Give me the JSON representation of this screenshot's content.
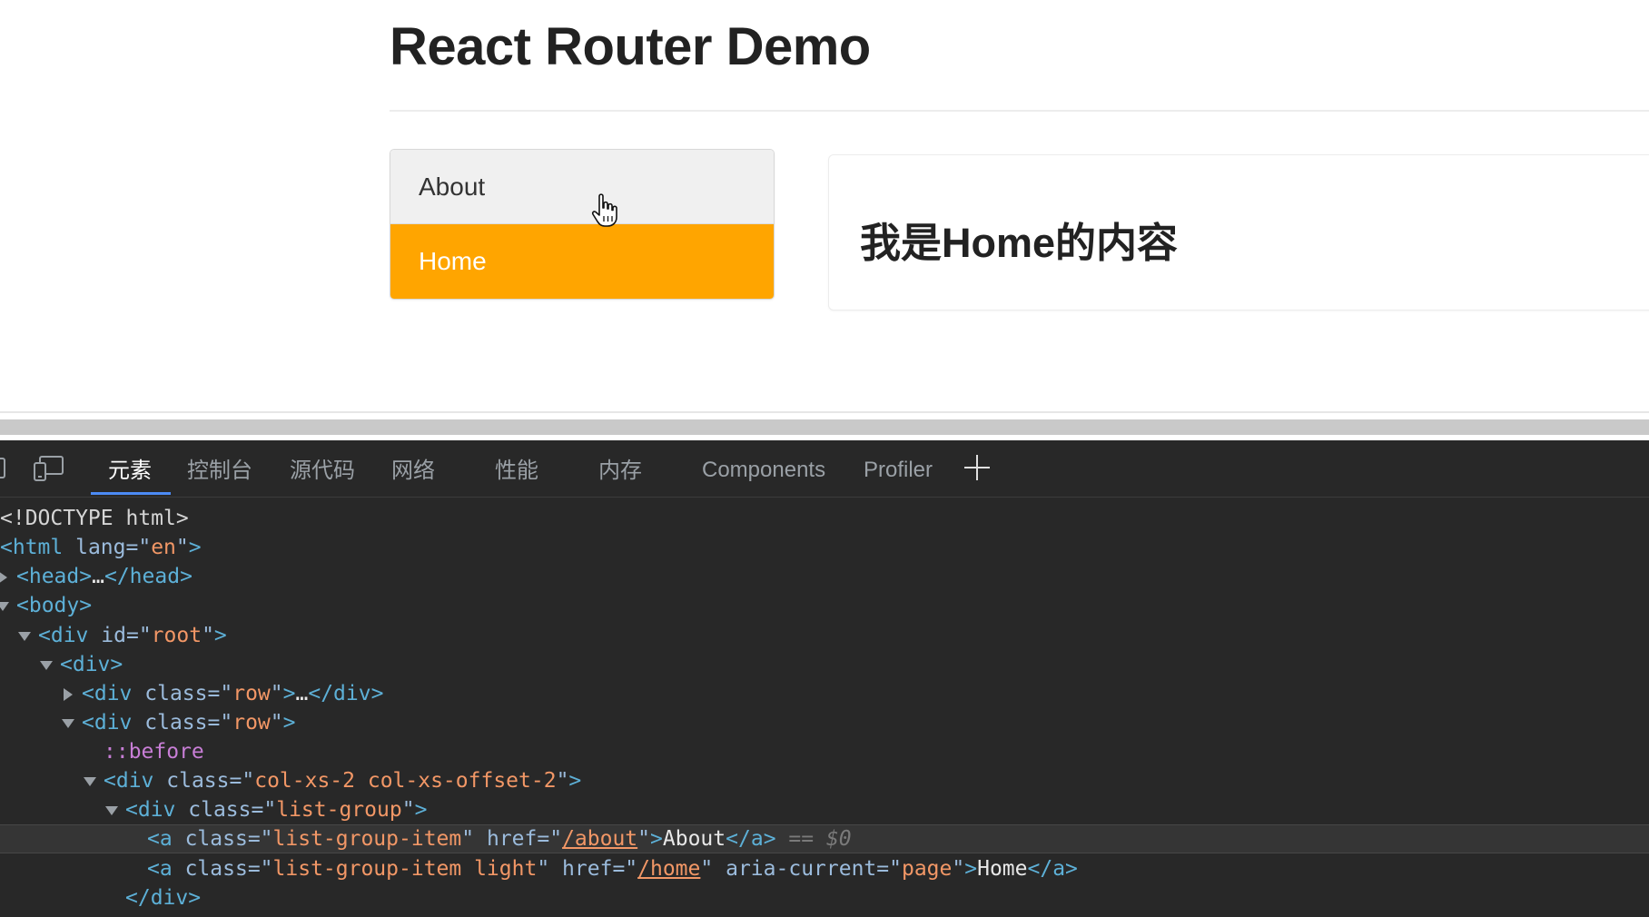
{
  "page": {
    "title": "React Router Demo",
    "nav": [
      {
        "label": "About",
        "active": false
      },
      {
        "label": "Home",
        "active": true
      }
    ],
    "content_heading": "我是Home的内容",
    "accent_color": "#ffa500"
  },
  "devtools": {
    "tabs": [
      {
        "label": "元素",
        "active": true
      },
      {
        "label": "控制台"
      },
      {
        "label": "源代码"
      },
      {
        "label": "网络"
      },
      {
        "label": "性能"
      },
      {
        "label": "内存"
      },
      {
        "label": "Components"
      },
      {
        "label": "Profiler"
      }
    ],
    "icons": [
      "inspect-icon",
      "device-toggle-icon",
      "add-tab-icon"
    ],
    "dom_tree": {
      "doctype": "<!DOCTYPE html>",
      "html_tag": "html",
      "lang_attr": "lang",
      "lang_val": "en",
      "head_tag": "head",
      "ellipsis": "…",
      "body_tag": "body",
      "div_tag": "div",
      "id_attr": "id",
      "root_val": "root",
      "class_attr": "class",
      "row_val": "row",
      "before_pseudo": "::before",
      "col_val": "col-xs-2 col-xs-offset-2",
      "list_group_val": "list-group",
      "a_tag": "a",
      "item_class_val": "list-group-item",
      "item_light_class_val": "list-group-item light",
      "href_attr": "href",
      "about_href": "/about",
      "about_text": "About",
      "selected_marker": "== $0",
      "home_href": "/home",
      "aria_attr": "aria-current",
      "aria_val": "page",
      "home_text": "Home"
    }
  }
}
